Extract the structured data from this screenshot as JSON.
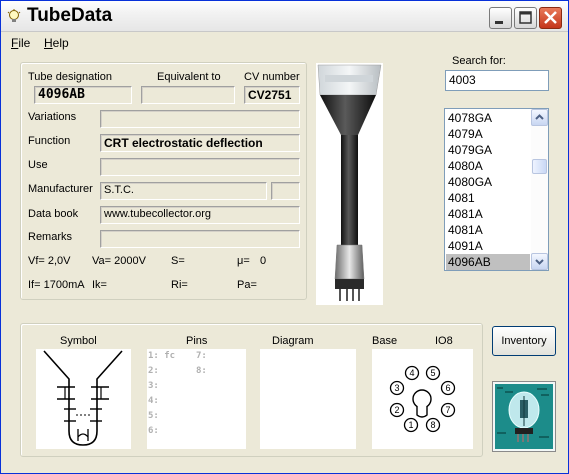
{
  "window": {
    "title": "TubeData"
  },
  "menu": {
    "file": "File",
    "file_rest": "ile",
    "file_key": "F",
    "help": "Help",
    "help_rest": "elp",
    "help_key": "H"
  },
  "labels": {
    "tube_designation": "Tube designation",
    "equivalent_to": "Equivalent to",
    "cv_number": "CV number",
    "variations": "Variations",
    "function": "Function",
    "use": "Use",
    "manufacturer": "Manufacturer",
    "data_book": "Data book",
    "remarks": "Remarks",
    "search_for": "Search for:"
  },
  "values": {
    "tube_designation": "4096AB",
    "equivalent_to": "",
    "cv_number": "CV2751",
    "variations": "",
    "function": "CRT electrostatic deflection",
    "use": "",
    "manufacturer": "S.T.C.",
    "manufacturer_extra": "",
    "data_book": "www.tubecollector.org",
    "remarks": ""
  },
  "params": {
    "vf": "Vf= 2,0V",
    "va": "Va= 2000V",
    "s": "S=",
    "mu": "μ=",
    "mu_value": "0",
    "if": "If= 1700mA",
    "ik": "Ik=",
    "ri": "Ri=",
    "pa": "Pa="
  },
  "search": {
    "value": "4003"
  },
  "list": {
    "items": [
      "4078GA",
      "4079A",
      "4079GA",
      "4080A",
      "4080GA",
      "4081",
      "4081A",
      "4081A",
      "4091A",
      "4096AB"
    ],
    "selected_index": 9
  },
  "bottom": {
    "symbol": "Symbol",
    "pins": "Pins",
    "diagram": "Diagram",
    "base": "Base",
    "base_type": "IO8",
    "pin_lines": [
      "1: fc",
      "2:",
      "3:",
      "4:",
      "5:",
      "6:",
      "7:",
      "8:"
    ],
    "base_pins": [
      "1",
      "2",
      "3",
      "4",
      "5",
      "6",
      "7",
      "8"
    ]
  },
  "buttons": {
    "inventory": "Inventory"
  },
  "colors": {
    "accent_close": "#c4351a",
    "selection": "#c0c0c0",
    "face": "#ece9d8"
  },
  "icons": [
    "bulb-icon",
    "minimize-icon",
    "maximize-icon",
    "close-icon",
    "scroll-up-icon",
    "scroll-down-icon"
  ]
}
